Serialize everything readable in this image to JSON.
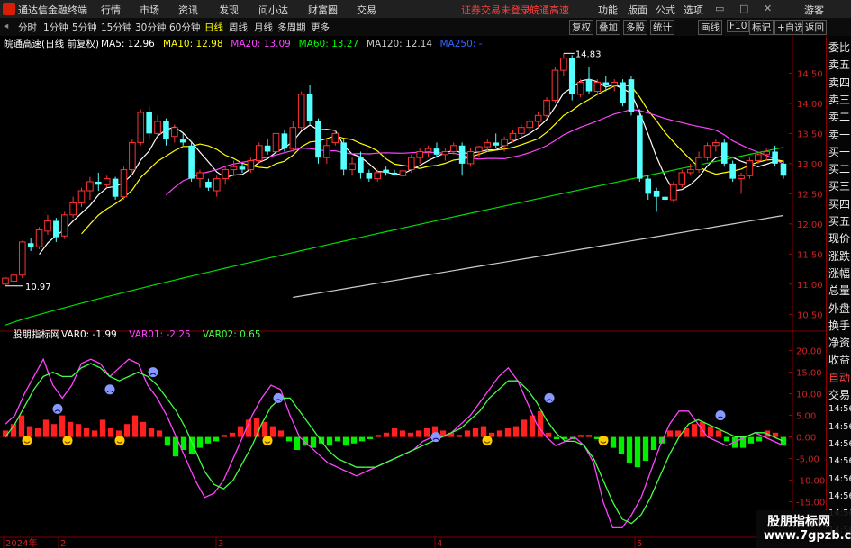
{
  "app": {
    "title": "通达信金融终端",
    "login_status": "证券交易未登录",
    "current_stock": "皖通高速",
    "guest_label": "游客"
  },
  "main_menu": [
    "行情",
    "市场",
    "资讯",
    "发现",
    "问小达",
    "财富圈",
    "交易"
  ],
  "right_menu": [
    "功能",
    "版面",
    "公式",
    "选项"
  ],
  "periods": [
    "分时",
    "1分钟",
    "5分钟",
    "15分钟",
    "30分钟",
    "60分钟",
    "日线",
    "周线",
    "月线",
    "多周期",
    "更多"
  ],
  "active_period": "日线",
  "toolbar_buttons": [
    "复权",
    "叠加",
    "多股",
    "统计",
    "画线",
    "F10",
    "标记",
    "+自选",
    "返回"
  ],
  "main_legend": {
    "prefix": "皖通高速(日线 前复权)",
    "items": [
      {
        "label": "MA5: 12.96",
        "color": "#ffffff"
      },
      {
        "label": "MA10: 12.98",
        "color": "#ffff00"
      },
      {
        "label": "MA20: 13.09",
        "color": "#ff44ff"
      },
      {
        "label": "MA60: 13.27",
        "color": "#00ff00"
      },
      {
        "label": "MA120: 12.14",
        "color": "#cccccc"
      },
      {
        "label": "MA250: -",
        "color": "#3366ff"
      }
    ]
  },
  "sub_legend": {
    "prefix": "股朋指标网",
    "items": [
      {
        "label": "VAR0: -1.99",
        "color": "#ffffff"
      },
      {
        "label": "VAR01: -2.25",
        "color": "#ff44ff"
      },
      {
        "label": "VAR02: 0.65",
        "color": "#44ff44"
      }
    ]
  },
  "side_panel": [
    "委比",
    "卖五",
    "卖四",
    "卖三",
    "卖二",
    "卖一",
    "买一",
    "买二",
    "买三",
    "买四",
    "买五",
    "现价",
    "涨跌",
    "涨幅",
    "总量",
    "外盘",
    "换手",
    "净资",
    "收益",
    "自动",
    "交易",
    "14:56",
    "14:56",
    "14:56",
    "14:56",
    "14:56",
    "14:56",
    "14:56",
    "14:56"
  ],
  "watermark": {
    "line1": "股朋指标网",
    "line2": "www.7gpzb.com"
  },
  "chart_data": [
    {
      "type": "candlestick",
      "title": "皖通高速(日线 前复权)",
      "y_ticks": [
        10.5,
        11.0,
        11.5,
        12.0,
        12.5,
        13.0,
        13.5,
        14.0,
        14.5
      ],
      "ylim": [
        10.25,
        14.85
      ],
      "x_labels": [
        "2024年",
        "2",
        "3",
        "4",
        "5"
      ],
      "annotations": [
        {
          "label": "10.97",
          "kind": "low"
        },
        {
          "label": "14.83",
          "kind": "high"
        }
      ],
      "candles": [
        {
          "o": 11.0,
          "h": 11.12,
          "l": 10.97,
          "c": 11.1
        },
        {
          "o": 11.05,
          "h": 11.2,
          "l": 10.98,
          "c": 11.15
        },
        {
          "o": 11.15,
          "h": 11.72,
          "l": 11.1,
          "c": 11.7
        },
        {
          "o": 11.68,
          "h": 11.76,
          "l": 11.55,
          "c": 11.62
        },
        {
          "o": 11.62,
          "h": 11.95,
          "l": 11.58,
          "c": 11.9
        },
        {
          "o": 11.88,
          "h": 12.15,
          "l": 11.82,
          "c": 12.05
        },
        {
          "o": 12.05,
          "h": 12.1,
          "l": 11.7,
          "c": 11.78
        },
        {
          "o": 11.8,
          "h": 12.2,
          "l": 11.75,
          "c": 12.15
        },
        {
          "o": 12.15,
          "h": 12.45,
          "l": 12.1,
          "c": 12.35
        },
        {
          "o": 12.35,
          "h": 12.6,
          "l": 12.28,
          "c": 12.55
        },
        {
          "o": 12.55,
          "h": 12.78,
          "l": 12.4,
          "c": 12.7
        },
        {
          "o": 12.7,
          "h": 12.85,
          "l": 12.55,
          "c": 12.65
        },
        {
          "o": 12.65,
          "h": 12.8,
          "l": 12.6,
          "c": 12.75
        },
        {
          "o": 12.75,
          "h": 12.78,
          "l": 12.4,
          "c": 12.45
        },
        {
          "o": 12.45,
          "h": 12.95,
          "l": 12.4,
          "c": 12.9
        },
        {
          "o": 12.9,
          "h": 13.4,
          "l": 12.85,
          "c": 13.35
        },
        {
          "o": 13.35,
          "h": 13.9,
          "l": 13.3,
          "c": 13.85
        },
        {
          "o": 13.85,
          "h": 13.95,
          "l": 13.4,
          "c": 13.5
        },
        {
          "o": 13.5,
          "h": 13.8,
          "l": 13.45,
          "c": 13.7
        },
        {
          "o": 13.7,
          "h": 13.75,
          "l": 13.3,
          "c": 13.4
        },
        {
          "o": 13.45,
          "h": 13.65,
          "l": 13.35,
          "c": 13.6
        },
        {
          "o": 13.4,
          "h": 13.5,
          "l": 13.3,
          "c": 13.35
        },
        {
          "o": 13.3,
          "h": 13.35,
          "l": 12.7,
          "c": 12.75
        },
        {
          "o": 12.75,
          "h": 12.9,
          "l": 12.6,
          "c": 12.85
        },
        {
          "o": 12.7,
          "h": 12.75,
          "l": 12.55,
          "c": 12.6
        },
        {
          "o": 12.55,
          "h": 12.8,
          "l": 12.45,
          "c": 12.75
        },
        {
          "o": 12.75,
          "h": 12.95,
          "l": 12.65,
          "c": 12.9
        },
        {
          "o": 12.9,
          "h": 13.05,
          "l": 12.8,
          "c": 12.95
        },
        {
          "o": 12.95,
          "h": 13.0,
          "l": 12.85,
          "c": 12.9
        },
        {
          "o": 12.9,
          "h": 13.1,
          "l": 12.85,
          "c": 13.05
        },
        {
          "o": 13.05,
          "h": 13.35,
          "l": 13.0,
          "c": 13.3
        },
        {
          "o": 13.3,
          "h": 13.4,
          "l": 13.15,
          "c": 13.2
        },
        {
          "o": 13.2,
          "h": 13.55,
          "l": 13.15,
          "c": 13.5
        },
        {
          "o": 13.5,
          "h": 13.55,
          "l": 13.2,
          "c": 13.25
        },
        {
          "o": 13.25,
          "h": 13.7,
          "l": 13.2,
          "c": 13.6
        },
        {
          "o": 13.6,
          "h": 14.2,
          "l": 13.55,
          "c": 14.15
        },
        {
          "o": 14.15,
          "h": 14.3,
          "l": 13.65,
          "c": 13.7
        },
        {
          "o": 13.7,
          "h": 13.75,
          "l": 13.0,
          "c": 13.1
        },
        {
          "o": 13.1,
          "h": 13.4,
          "l": 13.0,
          "c": 13.3
        },
        {
          "o": 13.35,
          "h": 13.55,
          "l": 13.3,
          "c": 13.5
        },
        {
          "o": 13.35,
          "h": 13.4,
          "l": 12.8,
          "c": 12.9
        },
        {
          "o": 12.9,
          "h": 13.1,
          "l": 12.8,
          "c": 13.0
        },
        {
          "o": 13.1,
          "h": 13.2,
          "l": 12.75,
          "c": 12.85
        },
        {
          "o": 12.85,
          "h": 12.9,
          "l": 12.7,
          "c": 12.75
        },
        {
          "o": 12.75,
          "h": 12.9,
          "l": 12.7,
          "c": 12.85
        },
        {
          "o": 12.9,
          "h": 12.95,
          "l": 12.8,
          "c": 12.85
        },
        {
          "o": 12.85,
          "h": 12.9,
          "l": 12.8,
          "c": 12.82
        },
        {
          "o": 12.8,
          "h": 12.9,
          "l": 12.75,
          "c": 12.88
        },
        {
          "o": 12.9,
          "h": 13.15,
          "l": 12.85,
          "c": 13.1
        },
        {
          "o": 13.1,
          "h": 13.25,
          "l": 13.0,
          "c": 13.2
        },
        {
          "o": 13.2,
          "h": 13.3,
          "l": 13.1,
          "c": 13.25
        },
        {
          "o": 13.25,
          "h": 13.35,
          "l": 13.1,
          "c": 13.15
        },
        {
          "o": 13.15,
          "h": 13.25,
          "l": 13.05,
          "c": 13.2
        },
        {
          "o": 13.2,
          "h": 13.35,
          "l": 13.15,
          "c": 13.3
        },
        {
          "o": 13.3,
          "h": 13.35,
          "l": 12.8,
          "c": 13.0
        },
        {
          "o": 13.0,
          "h": 13.25,
          "l": 12.95,
          "c": 13.2
        },
        {
          "o": 13.2,
          "h": 13.3,
          "l": 13.1,
          "c": 13.28
        },
        {
          "o": 13.28,
          "h": 13.4,
          "l": 13.2,
          "c": 13.35
        },
        {
          "o": 13.35,
          "h": 13.5,
          "l": 13.25,
          "c": 13.3
        },
        {
          "o": 13.3,
          "h": 13.45,
          "l": 13.2,
          "c": 13.4
        },
        {
          "o": 13.4,
          "h": 13.55,
          "l": 13.35,
          "c": 13.5
        },
        {
          "o": 13.5,
          "h": 13.65,
          "l": 13.4,
          "c": 13.6
        },
        {
          "o": 13.6,
          "h": 13.75,
          "l": 13.5,
          "c": 13.7
        },
        {
          "o": 13.7,
          "h": 13.85,
          "l": 13.6,
          "c": 13.8
        },
        {
          "o": 13.8,
          "h": 14.1,
          "l": 13.75,
          "c": 14.05
        },
        {
          "o": 14.05,
          "h": 14.6,
          "l": 14.0,
          "c": 14.55
        },
        {
          "o": 14.55,
          "h": 14.83,
          "l": 14.45,
          "c": 14.75
        },
        {
          "o": 14.75,
          "h": 14.8,
          "l": 14.05,
          "c": 14.15
        },
        {
          "o": 14.15,
          "h": 14.4,
          "l": 14.1,
          "c": 14.35
        },
        {
          "o": 14.4,
          "h": 14.6,
          "l": 14.15,
          "c": 14.2
        },
        {
          "o": 14.2,
          "h": 14.4,
          "l": 14.15,
          "c": 14.35
        },
        {
          "o": 14.35,
          "h": 14.45,
          "l": 14.2,
          "c": 14.3
        },
        {
          "o": 14.3,
          "h": 14.4,
          "l": 14.2,
          "c": 14.35
        },
        {
          "o": 14.35,
          "h": 14.4,
          "l": 13.95,
          "c": 14.0
        },
        {
          "o": 14.4,
          "h": 14.45,
          "l": 13.8,
          "c": 13.85
        },
        {
          "o": 13.8,
          "h": 13.9,
          "l": 12.7,
          "c": 12.75
        },
        {
          "o": 12.75,
          "h": 12.8,
          "l": 12.4,
          "c": 12.5
        },
        {
          "o": 12.55,
          "h": 12.6,
          "l": 12.2,
          "c": 12.45
        },
        {
          "o": 12.45,
          "h": 12.55,
          "l": 12.35,
          "c": 12.4
        },
        {
          "o": 12.4,
          "h": 12.7,
          "l": 12.35,
          "c": 12.65
        },
        {
          "o": 12.65,
          "h": 12.9,
          "l": 12.6,
          "c": 12.85
        },
        {
          "o": 12.85,
          "h": 13.0,
          "l": 12.8,
          "c": 12.9
        },
        {
          "o": 12.9,
          "h": 13.2,
          "l": 12.85,
          "c": 13.1
        },
        {
          "o": 13.1,
          "h": 13.35,
          "l": 13.05,
          "c": 13.3
        },
        {
          "o": 13.3,
          "h": 13.4,
          "l": 13.2,
          "c": 13.35
        },
        {
          "o": 13.35,
          "h": 13.4,
          "l": 12.95,
          "c": 13.0
        },
        {
          "o": 13.0,
          "h": 13.05,
          "l": 12.7,
          "c": 12.75
        },
        {
          "o": 12.75,
          "h": 12.85,
          "l": 12.5,
          "c": 12.8
        },
        {
          "o": 12.8,
          "h": 13.1,
          "l": 12.75,
          "c": 13.05
        },
        {
          "o": 13.05,
          "h": 13.2,
          "l": 13.0,
          "c": 13.15
        },
        {
          "o": 13.15,
          "h": 13.25,
          "l": 13.05,
          "c": 13.2
        },
        {
          "o": 13.2,
          "h": 13.3,
          "l": 12.95,
          "c": 13.0
        },
        {
          "o": 13.0,
          "h": 13.05,
          "l": 12.75,
          "c": 12.8
        }
      ]
    },
    {
      "type": "line+bar",
      "title": "股朋指标网",
      "y_ticks": [
        -20.0,
        -15.0,
        -10.0,
        -5.0,
        0.0,
        5.0,
        10.0,
        15.0,
        20.0
      ],
      "ylim": [
        -23,
        22
      ],
      "series": [
        {
          "name": "VAR0",
          "kind": "bar",
          "values": [
            1.5,
            3,
            5,
            2.5,
            2,
            4,
            3,
            5,
            3.5,
            3,
            2,
            1.5,
            4,
            2,
            1.5,
            3,
            5,
            3.5,
            2,
            1.5,
            -2,
            -4.5,
            -3,
            -4,
            -2.5,
            -1.5,
            -1,
            0.5,
            1,
            2.5,
            4,
            4.5,
            3.5,
            2.5,
            1.5,
            -1,
            -3,
            -2,
            -2.5,
            -1.5,
            -2,
            -1,
            -2,
            -1.5,
            -1,
            -0.5,
            0.5,
            1,
            2,
            1.5,
            1,
            1.5,
            2,
            2.5,
            1.5,
            1,
            0.5,
            1.5,
            2,
            2.5,
            1,
            1.5,
            2,
            2.5,
            4,
            5,
            6,
            1,
            -0.5,
            -0.5,
            -0.5,
            0.5,
            0.5,
            -0.5,
            -1,
            -2.5,
            -4,
            -6,
            -7,
            -5.5,
            -3,
            -1.5,
            1.5,
            1.5,
            2,
            3,
            3.5,
            2.5,
            1.5,
            -1,
            -2.5,
            -2.5,
            -1.5,
            -1,
            1.5,
            1,
            -2
          ]
        },
        {
          "name": "VAR01",
          "kind": "line",
          "values": [
            3,
            5,
            10,
            14,
            18,
            12,
            9,
            12,
            17,
            18,
            17,
            14,
            16,
            18,
            17,
            12,
            9,
            5,
            0,
            -5,
            -10,
            -14,
            -13,
            -10,
            -5,
            0,
            5,
            9,
            12,
            11,
            5,
            0,
            -2,
            -4,
            -6,
            -7,
            -8,
            -9,
            -8,
            -7,
            -6,
            -5,
            -4,
            -3,
            -1,
            0,
            0,
            1,
            3,
            5,
            8,
            11,
            14,
            16,
            13,
            8,
            3,
            0,
            -2,
            -1,
            0,
            -2,
            -6,
            -15,
            -21,
            -21,
            -18,
            -14,
            -8,
            -2,
            3,
            6,
            6,
            3,
            0,
            -1,
            -2,
            -1,
            0,
            1,
            0,
            -1,
            -2
          ]
        },
        {
          "name": "VAR02",
          "kind": "line",
          "values": [
            0,
            3,
            7,
            11,
            14,
            15,
            14,
            14,
            16,
            17,
            16,
            14,
            13,
            14,
            15,
            14,
            12,
            9,
            6,
            2,
            -3,
            -8,
            -11,
            -12,
            -10,
            -6,
            -2,
            3,
            7,
            9,
            9,
            6,
            3,
            0,
            -3,
            -5,
            -6,
            -7,
            -7,
            -7,
            -6,
            -5,
            -4,
            -3,
            -2,
            -1,
            0,
            1,
            2,
            4,
            6,
            9,
            11,
            13,
            13,
            11,
            8,
            4,
            1,
            -1,
            -1,
            -2,
            -5,
            -10,
            -15,
            -19,
            -20,
            -18,
            -14,
            -9,
            -4,
            0,
            3,
            4,
            3,
            2,
            1,
            0,
            0,
            1,
            1,
            0,
            -1
          ]
        }
      ],
      "markers": [
        {
          "kind": "smile",
          "count": 8
        },
        {
          "kind": "frown",
          "count": 7
        }
      ]
    }
  ]
}
